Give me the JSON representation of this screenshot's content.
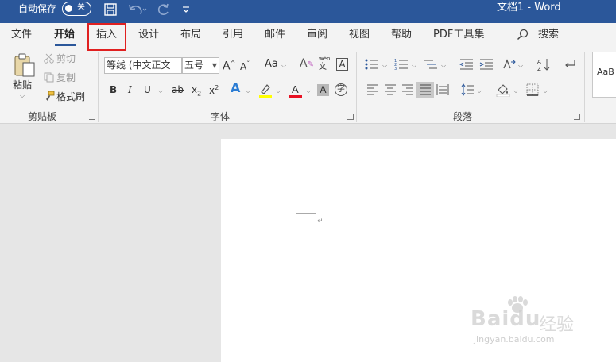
{
  "titlebar": {
    "autosave_label": "自动保存",
    "autosave_state": "关",
    "doc_title": "文档1  -  Word",
    "bg_color": "#2b579a"
  },
  "qat": [
    "save-icon",
    "undo-icon",
    "redo-icon",
    "customize-qat-icon"
  ],
  "tabs": [
    {
      "label": "文件"
    },
    {
      "label": "开始",
      "active": true
    },
    {
      "label": "插入",
      "highlighted": true
    },
    {
      "label": "设计"
    },
    {
      "label": "布局"
    },
    {
      "label": "引用"
    },
    {
      "label": "邮件"
    },
    {
      "label": "审阅"
    },
    {
      "label": "视图"
    },
    {
      "label": "帮助"
    },
    {
      "label": "PDF工具集"
    },
    {
      "label": "搜索"
    }
  ],
  "clipboard": {
    "paste": "粘贴",
    "cut": "剪切",
    "copy": "复制",
    "format_painter": "格式刷",
    "group_label": "剪贴板"
  },
  "font": {
    "font_name": "等线 (中文正文",
    "font_size": "五号",
    "group_label": "字体",
    "font_color": "#e81123",
    "highlight_color": "#ffff00"
  },
  "paragraph": {
    "group_label": "段落"
  },
  "styles": {
    "preview": "AaB"
  },
  "watermark": {
    "brand": "Baidu",
    "jingyan": "经验",
    "url": "jingyan.baidu.com"
  }
}
